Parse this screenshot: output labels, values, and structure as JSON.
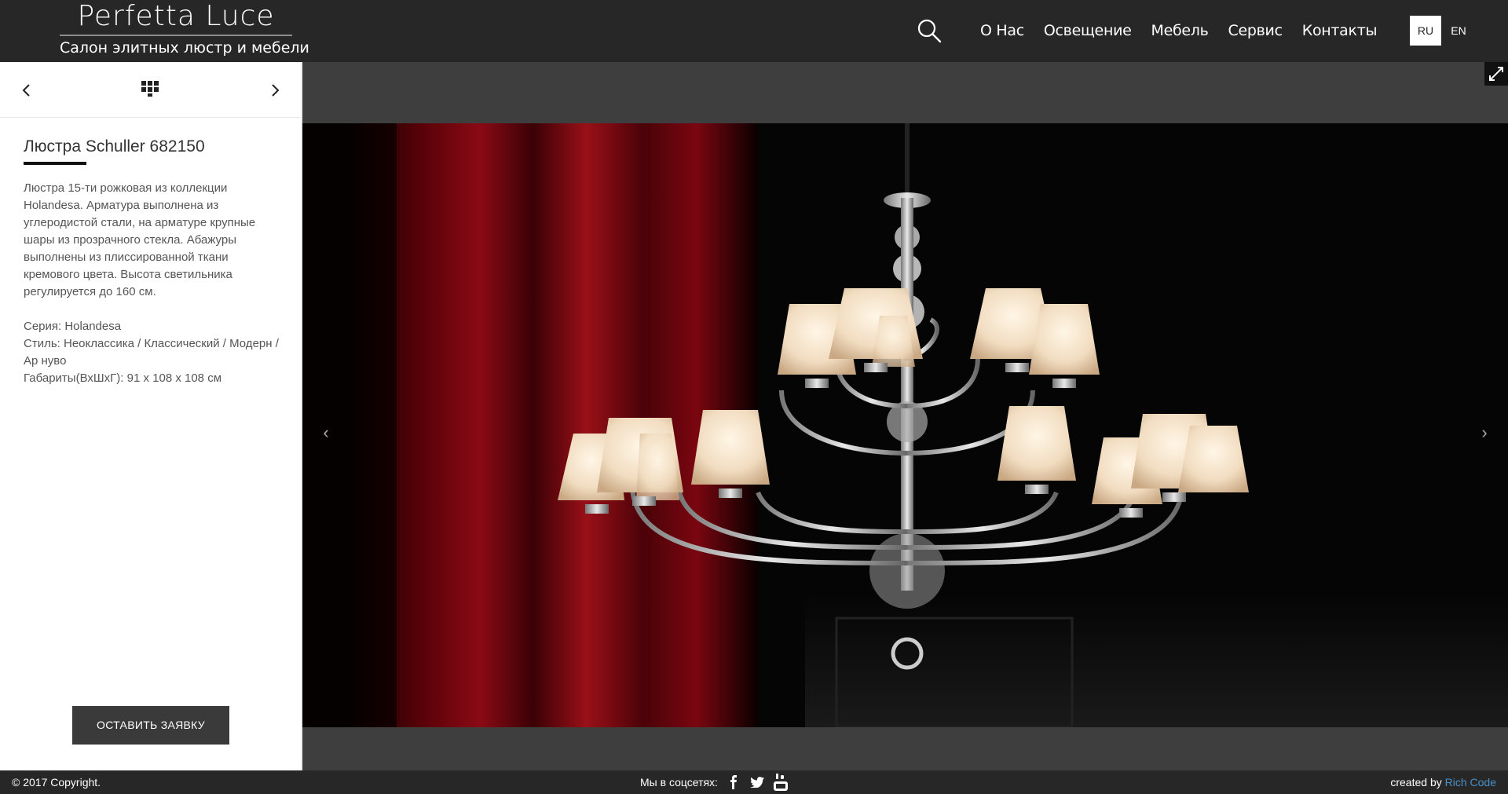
{
  "header": {
    "logo_title": "Perfetta Luce",
    "logo_subtitle": "Салон элитных люстр и мебели",
    "nav": [
      "О Нас",
      "Освещение",
      "Мебель",
      "Сервис",
      "Контакты"
    ],
    "lang_ru": "RU",
    "lang_en": "EN",
    "search_icon": "search-icon"
  },
  "sidebar": {
    "title": "Люстра Schuller 682150",
    "description": "Люстра 15-ти рожковая из коллекции Holandesa. Арматура выполнена из углеродистой стали, на арматуре крупные шары из прозрачного стекла. Абажуры выполнены из плиссированной ткани кремового цвета. Высота светильника регулируется до 160 см.",
    "specs": {
      "series": "Серия: Holandesa",
      "style": "Стиль: Неоклассика / Классический / Модерн / Ар нуво",
      "dimensions": "Габариты(ВхШхГ):  91 x 108 x 108 см"
    },
    "button": "ОСТАВИТЬ ЗАЯВКУ",
    "icons": {
      "prev": "chevron-left-icon",
      "next": "chevron-right-icon",
      "grid": "grid-icon"
    }
  },
  "gallery": {
    "prev_arrow": "‹",
    "next_arrow": "›",
    "fullscreen_icon": "expand-icon"
  },
  "footer": {
    "copyright": "© 2017 Copyright.",
    "social_label": "Мы в соцсетях:",
    "social_icons": [
      "facebook-icon",
      "twitter-icon",
      "youtube-icon"
    ],
    "credit_prefix": "created by",
    "credit_link": "Rich Code"
  },
  "colors": {
    "header_bg": "#272727",
    "gallery_bg": "#3e3e3e",
    "button_bg": "#3a3a3a",
    "accent_link": "#4a90c8"
  }
}
